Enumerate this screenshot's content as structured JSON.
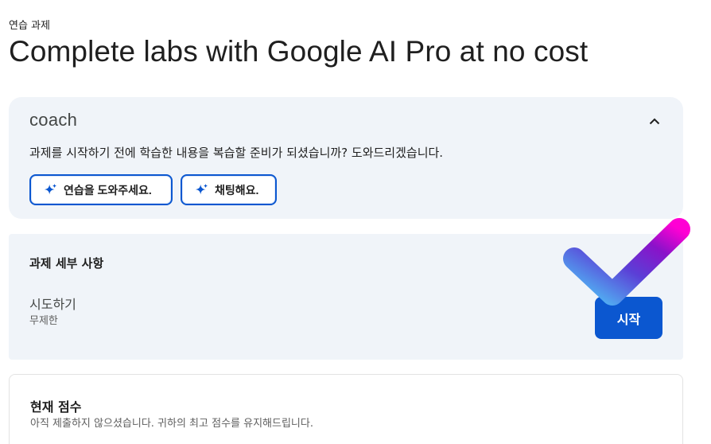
{
  "header": {
    "eyebrow": "연습 과제",
    "title": "Complete labs with Google AI Pro at no cost"
  },
  "coach": {
    "logo": "coach",
    "collapse_icon": "chevron-up-icon",
    "prompt": "과제를 시작하기 전에 학습한 내용을 복습할 준비가 되셨습니까? 도와드리겠습니다.",
    "chips": [
      {
        "label": "연습을 도와주세요.",
        "icon": "sparkle-icon"
      },
      {
        "label": "채팅해요.",
        "icon": "sparkle-icon"
      }
    ]
  },
  "details": {
    "title": "과제 세부 사항",
    "attempts_label": "시도하기",
    "attempts_value": "무제한",
    "start_label": "시작"
  },
  "score": {
    "title": "현재 점수",
    "description": "아직 제출하지 않으셨습니다. 귀하의 최고 점수를 유지해드립니다."
  },
  "colors": {
    "accent": "#0b57d0",
    "card_bg": "#f0f4f9",
    "check_gradient_start": "#4fc3f7",
    "check_gradient_end": "#ff00d4"
  }
}
